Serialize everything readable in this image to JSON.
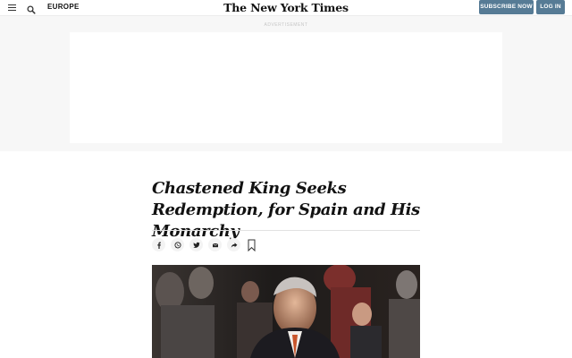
{
  "header": {
    "section": "EUROPE",
    "masthead": "The New York Times",
    "subscribe_label": "SUBSCRIBE NOW",
    "login_label": "LOG IN"
  },
  "ad": {
    "label": "ADVERTISEMENT"
  },
  "article": {
    "headline": "Chastened King Seeks Redemption, for Spain and His Monarchy"
  },
  "share": {
    "icons": [
      "facebook-icon",
      "whatsapp-icon",
      "twitter-icon",
      "email-icon",
      "share-icon",
      "bookmark-icon"
    ]
  },
  "colors": {
    "button_bg": "#567b95",
    "ad_band_bg": "#f7f7f7",
    "text": "#121212"
  }
}
